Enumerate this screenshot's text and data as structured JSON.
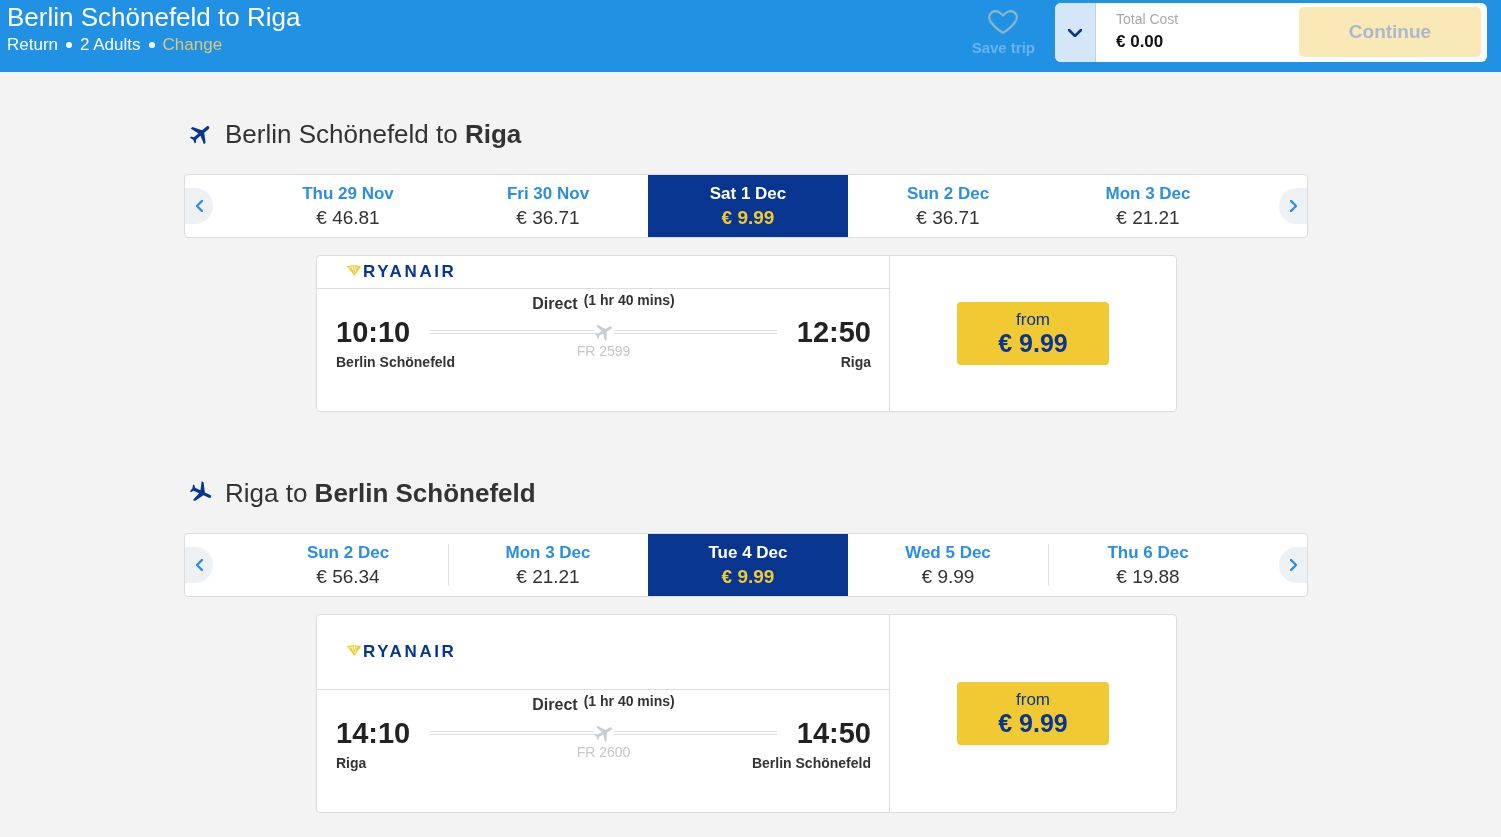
{
  "header": {
    "title": "Berlin Schönefeld to Riga",
    "trip_details": [
      "Return",
      "2 Adults"
    ],
    "change_link": "Change",
    "save_trip": {
      "label": "Save trip",
      "disabled": true
    },
    "total": {
      "label": "Total Cost",
      "value": "€ 0.00",
      "expanded": false
    },
    "continue_button": {
      "label": "Continue",
      "disabled": true
    }
  },
  "flights": [
    {
      "kind": "outbound",
      "heading": "Berlin Schönefeld to **Riga**",
      "dates": [
        {
          "date": "Thu 29 Nov",
          "price": "€ 46.81",
          "selected": false
        },
        {
          "date": "Fri 30 Nov",
          "price": "€ 36.71",
          "selected": false
        },
        {
          "date": "Sat 1 Dec",
          "price": "€ 9.99",
          "selected": true
        },
        {
          "date": "Sun 2 Dec",
          "price": "€ 36.71",
          "selected": false
        },
        {
          "date": "Mon 3 Dec",
          "price": "€ 21.21",
          "selected": false
        }
      ],
      "flight": {
        "airline": "RYANAIR",
        "stops": "Direct",
        "duration": "(1 hr 40 mins)",
        "depart_time": "10:10",
        "depart_airport": "Berlin Schönefeld",
        "arrive_time": "12:50",
        "arrive_airport": "Riga",
        "flight_number": "FR 2599",
        "price_label": "from",
        "price": "€ 9.99"
      }
    },
    {
      "kind": "inbound",
      "heading": "Riga to **Berlin Schönefeld**",
      "dates": [
        {
          "date": "Sun 2 Dec",
          "price": "€ 56.34",
          "selected": false
        },
        {
          "date": "Mon 3 Dec",
          "price": "€ 21.21",
          "selected": false
        },
        {
          "date": "Tue 4 Dec",
          "price": "€ 9.99",
          "selected": true
        },
        {
          "date": "Wed 5 Dec",
          "price": "€ 9.99",
          "selected": false
        },
        {
          "date": "Thu 6 Dec",
          "price": "€ 19.88",
          "selected": false
        }
      ],
      "flight": {
        "airline": "RYANAIR",
        "stops": "Direct",
        "duration": "(1 hr 40 mins)",
        "depart_time": "14:10",
        "depart_airport": "Riga",
        "arrive_time": "14:50",
        "arrive_airport": "Berlin Schönefeld",
        "flight_number": "FR 2600",
        "price_label": "from",
        "price": "€ 9.99"
      }
    }
  ]
}
